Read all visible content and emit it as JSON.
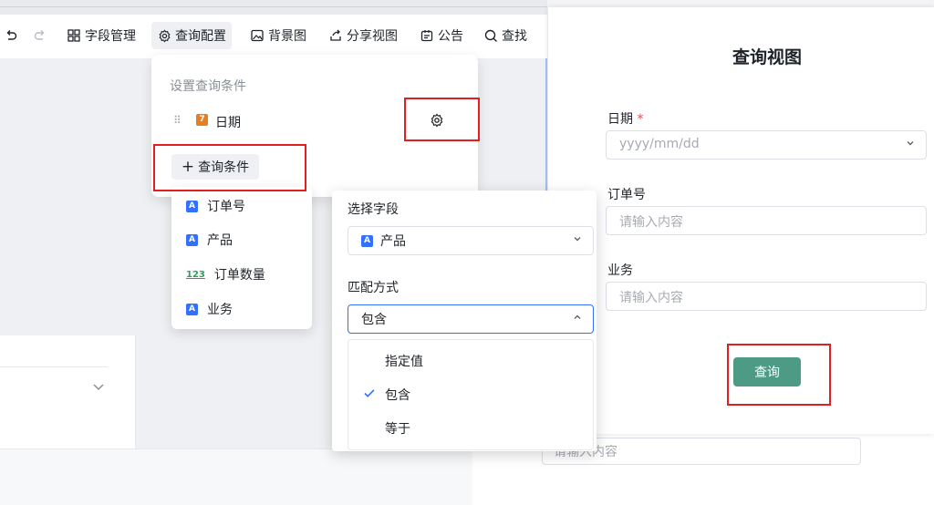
{
  "toolbar": {
    "undo_icon": "undo-icon",
    "redo_icon": "redo-icon",
    "items": [
      {
        "label": "字段管理",
        "icon": "grid-icon"
      },
      {
        "label": "查询配置",
        "icon": "gear-icon"
      },
      {
        "label": "背景图",
        "icon": "image-icon"
      },
      {
        "label": "分享视图",
        "icon": "share-icon"
      },
      {
        "label": "公告",
        "icon": "notice-icon"
      },
      {
        "label": "查找",
        "icon": "search-icon"
      }
    ]
  },
  "query_config": {
    "heading": "设置查询条件",
    "conditions": [
      {
        "label": "日期",
        "type_icon": "7"
      }
    ],
    "add_condition_label": "查询条件"
  },
  "field_menu": {
    "items": [
      {
        "label": "订单号",
        "type": "A"
      },
      {
        "label": "产品",
        "type": "A"
      },
      {
        "label": "订单数量",
        "type": "123"
      },
      {
        "label": "业务",
        "type": "A"
      }
    ]
  },
  "condition_panel": {
    "field_label": "选择字段",
    "field_value": "产品",
    "field_type": "A",
    "match_label": "匹配方式",
    "match_value": "包含",
    "match_options": [
      "指定值",
      "包含",
      "等于"
    ],
    "selected_option": "包含"
  },
  "preview": {
    "title": "查询视图",
    "fields": [
      {
        "label": "日期",
        "required_mark": "*",
        "placeholder": "yyyy/mm/dd"
      },
      {
        "label": "订单号",
        "placeholder": "请输入内容"
      },
      {
        "label": "业务",
        "placeholder": "请输入内容"
      }
    ],
    "query_button": "查询"
  },
  "background_form": {
    "partial_placeholder": "请输入内容"
  },
  "colors": {
    "accent": "#3370ff",
    "query_button": "#4d9b85",
    "highlight_box": "#e02020"
  }
}
